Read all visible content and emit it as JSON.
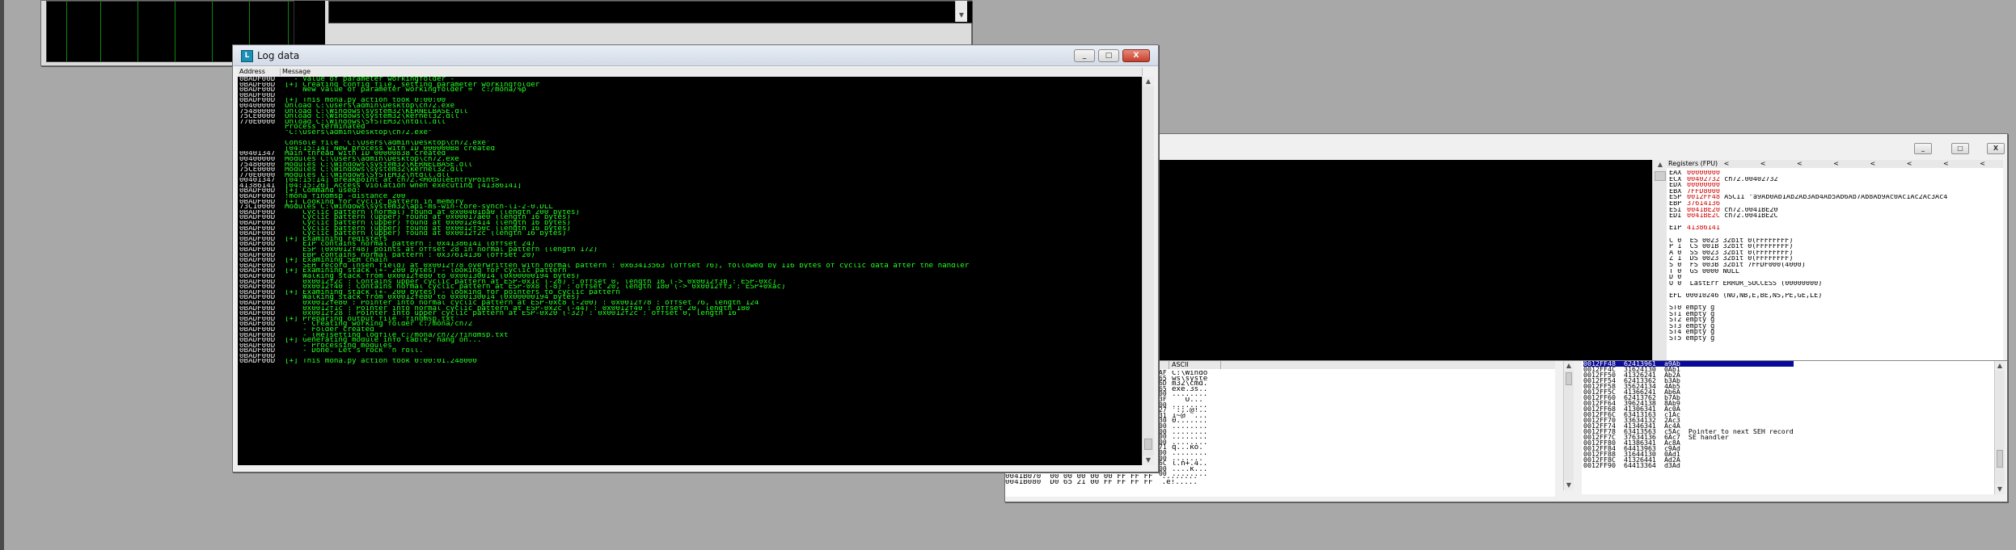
{
  "log_window": {
    "title": "Log data",
    "col_address": "Address",
    "col_message": "Message",
    "rows": [
      [
        "0BADF00D",
        "  - Value of parameter workingfolder -"
      ],
      [
        "0BADF00D",
        "[+] Creating config file, setting parameter workingfolder"
      ],
      [
        "0BADF00D",
        "    New value of parameter workingfolder =  c:/mona/%p"
      ],
      [
        "0BADF00D",
        ""
      ],
      [
        "0BADF00D",
        "[+] This mona.py action took 0:00:00"
      ],
      [
        "00400000",
        "Unload C:\\Users\\admin\\Desktop\\ch72.exe"
      ],
      [
        "75480000",
        "Unload C:\\Windows\\system32\\KERNELBASE.dll"
      ],
      [
        "75CE0000",
        "Unload C:\\Windows\\system32\\kernel32.dll"
      ],
      [
        "770E0000",
        "Unload C:\\Windows\\SYSTEM32\\ntdll.dll"
      ],
      [
        "",
        "Process terminated"
      ],
      [
        "",
        "\"C:\\Users\\admin\\Desktop\\ch72.exe\""
      ],
      [
        "",
        ""
      ],
      [
        "",
        "Console file 'C:\\Users\\admin\\Desktop\\ch72.exe'"
      ],
      [
        "",
        "[04:15:14] New process with ID 000000B8 created"
      ],
      [
        "00401347",
        "Main thread with ID 00000838 created"
      ],
      [
        "00400000",
        "Modules C:\\Users\\admin\\Desktop\\ch72.exe"
      ],
      [
        "75480000",
        "Modules C:\\Windows\\system32\\KERNELBASE.dll"
      ],
      [
        "75CE0000",
        "Modules C:\\Windows\\system32\\kernel32.dll"
      ],
      [
        "770E0000",
        "Modules C:\\Windows\\SYSTEM32\\ntdll.dll"
      ],
      [
        "00401347",
        "[04:15:14] Breakpoint at ch72.<ModuleEntryPoint>"
      ],
      [
        "41386141",
        "[04:15:26] Access violation when executing [41386141]"
      ],
      [
        "0BADF00D",
        "[+] Command used:"
      ],
      [
        "0BADF00D",
        "!mona findmsp -distance 200"
      ],
      [
        "0BADF00D",
        "[+] Looking for cyclic pattern in memory"
      ],
      [
        "73C10000",
        "Modules C:\\Windows\\system32\\api-ms-win-core-synch-l1-2-0.DLL"
      ],
      [
        "0BADF00D",
        "    Cyclic pattern (normal) found at 0x00401ba0 (length 200 bytes)"
      ],
      [
        "0BADF00D",
        "    Cyclic pattern (upper) found at 0x00017ae0 (length 16 bytes)"
      ],
      [
        "0BADF00D",
        "    Cyclic pattern (upper) found at 0x0012e414 (length 16 bytes)"
      ],
      [
        "0BADF00D",
        "    Cyclic pattern (upper) found at 0x0012f50c (length 16 bytes)"
      ],
      [
        "0BADF00D",
        "    Cyclic pattern (upper) found at 0x0012f2c (length 16 bytes)"
      ],
      [
        "0BADF00D",
        "[+] Examining registers"
      ],
      [
        "0BADF00D",
        "    EIP contains normal pattern : 0x41386141 (offset 24)"
      ],
      [
        "0BADF00D",
        "    ESP (0x0012f48) points at offset 28 in normal pattern (length 172)"
      ],
      [
        "0BADF00D",
        "    EBP contains normal pattern : 0x37614136 (offset 20)"
      ],
      [
        "0BADF00D",
        "[+] Examining SEH chain"
      ],
      [
        "0BADF00D",
        "    SEH record (nseh field) at 0x0012f78 overwritten with normal pattern : 0x63413563 (offset 76), followed by 116 bytes of cyclic data after the handler"
      ],
      [
        "0BADF00D",
        "[+] Examining stack (+- 200 bytes) - looking for cyclic pattern"
      ],
      [
        "0BADF00D",
        "    Walking stack from 0x0012fe80 to 0x00130014 (0x00000194 bytes)"
      ],
      [
        "0BADF00D",
        "    0x0012f2c : Contains upper cyclic pattern at ESP-0x1c (-28) : offset 0, length 16 (-> 0x0012f3b : ESP-0xc)"
      ],
      [
        "0BADF00D",
        "    0x0012f40 : Contains normal cyclic pattern at ESP-0x8 (-8) : offset 20, length 180 (-> 0x0012ff3 : ESP+0xac)"
      ],
      [
        "0BADF00D",
        "[+] Examining stack (+- 200 bytes) - looking for pointers to cyclic pattern"
      ],
      [
        "0BADF00D",
        "    Walking stack from 0x0012fe80 to 0x00130014 (0x00000194 bytes)"
      ],
      [
        "0BADF00D",
        "    0x0012fe80 : Pointer into normal cyclic pattern at ESP-0xc8 (-200) : 0x0012f78 : offset 76, length 124"
      ],
      [
        "0BADF00D",
        "    0x0012f1c : Pointer into normal cyclic pattern at ESP-0x2c (-44) : 0x0012f40 : offset 20, length 180"
      ],
      [
        "0BADF00D",
        "    0x0012f28 : Pointer into upper cyclic pattern at ESP-0x20 (-32) : 0x0012f2c : offset 0, length 16"
      ],
      [
        "0BADF00D",
        "[+] Preparing output file 'findmsp.txt'"
      ],
      [
        "0BADF00D",
        "    - Creating working folder c:/mona/ch72"
      ],
      [
        "0BADF00D",
        "    - Folder created"
      ],
      [
        "0BADF00D",
        "    - (Re)setting logfile c:/mona/ch72/findmsp.txt"
      ],
      [
        "0BADF00D",
        "[+] Generating module info table, hang on..."
      ],
      [
        "0BADF00D",
        "    - Processing modules"
      ],
      [
        "0BADF00D",
        "    - Done. Let's rock 'n roll."
      ],
      [
        "0BADF00D",
        ""
      ],
      [
        "0BADF00D",
        "[+] This mona.py action took 0:00:01.248000"
      ]
    ]
  },
  "debugger": {
    "registers_header": "Registers (FPU)",
    "nav_arrows": "< < < < < < < <",
    "registers": [
      {
        "name": "EAX",
        "value": "00000000",
        "extra": ""
      },
      {
        "name": "ECX",
        "value": "00402732",
        "extra": "ch72.00402732"
      },
      {
        "name": "EDX",
        "value": "00000000",
        "extra": ""
      },
      {
        "name": "EBX",
        "value": "7FFD8000",
        "extra": ""
      },
      {
        "name": "ESP",
        "value": "0012FF48",
        "extra": "ASCII \"a9Ab0Ab1Ab2Ab3Ab4Ab5Ab6Ab7Ab8Ab9Ac0Ac1Ac2Ac3Ac4"
      },
      {
        "name": "EBP",
        "value": "37614136",
        "extra": ""
      },
      {
        "name": "ESI",
        "value": "0041BE20",
        "extra": "ch72.0041BE20"
      },
      {
        "name": "EDI",
        "value": "0041BE2C",
        "extra": "ch72.0041BE2C"
      },
      {
        "name": "",
        "value": "",
        "extra": ""
      },
      {
        "name": "EIP",
        "value": "41386141",
        "extra": ""
      }
    ],
    "flags": [
      "C 0  ES 0023 32bit 0(FFFFFFFF)",
      "P 1  CS 001B 32bit 0(FFFFFFFF)",
      "A 0  SS 0023 32bit 0(FFFFFFFF)",
      "Z 1  DS 0023 32bit 0(FFFFFFFF)",
      "S 0  FS 003B 32bit 7FFDF000(4000)",
      "T 0  GS 0000 NULL",
      "D 0",
      "O 0  LastErr ERROR_SUCCESS (00000000)"
    ],
    "efl": "EFL 00010246 (NO,NB,E,BE,NS,PE,GE,LE)",
    "fpu": [
      "ST0 empty g",
      "ST1 empty g",
      "ST2 empty g",
      "ST3 empty g",
      "ST4 empty g",
      "ST5 empty g"
    ],
    "dump_col_ascii": "ASCII",
    "dump_ascii": [
      "C:\\Windo",
      "ws\\syste",
      "m32\\cmd.",
      "exe.3s..",
      "........",
      "   O...",
      "........",
      "':;.@!..",
      "1~@  ...",
      "0.......",
      "........",
      "........",
      "........",
      "........",
      "q...ko.",
      "........",
      ".......",
      "l.h+.4..",
      "....k...",
      "........"
    ],
    "dump_left_stub": [
      "AF",
      "65",
      "6D",
      "65",
      "00",
      "3F",
      "00",
      "27",
      "31",
      "30",
      "00",
      "00",
      "00",
      "00",
      "71",
      "00",
      "00",
      "6C",
      "00",
      "00"
    ],
    "dump_bottom": [
      "0041B070  00 00 00 00 00 FF FF FF  ........",
      "0041B080  D0 65 21 00 FF FF FF FF  .e!....."
    ],
    "stack": [
      {
        "addr": "0012FF48",
        "val": "62413961",
        "cmt": "a9Ab",
        "sel": true
      },
      {
        "addr": "0012FF4C",
        "val": "31624130",
        "cmt": "0Ab1"
      },
      {
        "addr": "0012FF50",
        "val": "41326241",
        "cmt": "Ab2A"
      },
      {
        "addr": "0012FF54",
        "val": "62413362",
        "cmt": "b3Ab"
      },
      {
        "addr": "0012FF58",
        "val": "35624134",
        "cmt": "4Ab5"
      },
      {
        "addr": "0012FF5C",
        "val": "41366241",
        "cmt": "Ab6A"
      },
      {
        "addr": "0012FF60",
        "val": "62413762",
        "cmt": "b7Ab"
      },
      {
        "addr": "0012FF64",
        "val": "39624138",
        "cmt": "8Ab9"
      },
      {
        "addr": "0012FF68",
        "val": "41306341",
        "cmt": "Ac0A"
      },
      {
        "addr": "0012FF6C",
        "val": "63413163",
        "cmt": "c1Ac"
      },
      {
        "addr": "0012FF70",
        "val": "33634132",
        "cmt": "2Ac3"
      },
      {
        "addr": "0012FF74",
        "val": "41346341",
        "cmt": "Ac4A"
      },
      {
        "addr": "0012FF78",
        "val": "63413563",
        "cmt": "c5Ac  Pointer to next SEH record"
      },
      {
        "addr": "0012FF7C",
        "val": "37634136",
        "cmt": "6Ac7  SE handler"
      },
      {
        "addr": "0012FF80",
        "val": "41386341",
        "cmt": "Ac8A"
      },
      {
        "addr": "0012FF84",
        "val": "64413963",
        "cmt": "c9Ad"
      },
      {
        "addr": "0012FF88",
        "val": "31644130",
        "cmt": "0Ad1"
      },
      {
        "addr": "0012FF8C",
        "val": "41326441",
        "cmt": "Ad2A"
      },
      {
        "addr": "0012FF90",
        "val": "64413364",
        "cmt": "d3Ad"
      }
    ]
  },
  "window_buttons": {
    "min": "_",
    "max": "□",
    "close": "X"
  },
  "scroll": {
    "up": "▲",
    "down": "▼"
  }
}
